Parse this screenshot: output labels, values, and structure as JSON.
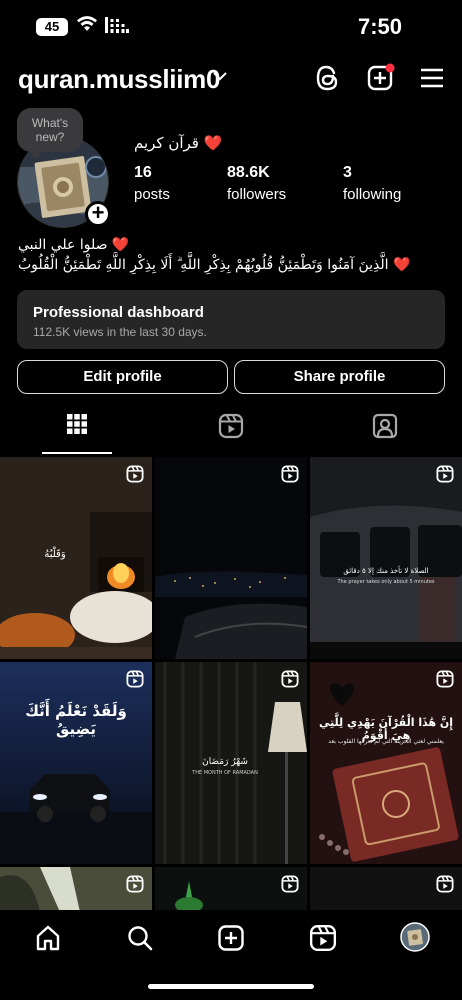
{
  "status_bar": {
    "battery": "45",
    "time": "7:50"
  },
  "header": {
    "username": "quran.mussliim0",
    "icons": [
      "chevron-down-icon",
      "threads-icon",
      "create-icon",
      "menu-icon"
    ],
    "notification_dot_color": "#ff3040"
  },
  "profile": {
    "note_text": "What's new?",
    "display_name": "قرآن كريم ❤️",
    "stats": [
      {
        "value": "16",
        "label": "posts"
      },
      {
        "value": "88.6K",
        "label": "followers"
      },
      {
        "value": "3",
        "label": "following"
      }
    ],
    "bio_line1": "صلوا علي النبي ❤️",
    "bio_line2": "الَّذِينَ آمَنُوا وَتَطْمَئِنُّ قُلُوبُهُمْ بِذِكْرِ اللَّهِ ۗ أَلَا بِذِكْرِ اللَّهِ تَطْمَئِنُّ الْقُلُوبُ ❤️"
  },
  "dashboard": {
    "title": "Professional dashboard",
    "subtitle": "112.5K views in the last 30 days."
  },
  "buttons": {
    "edit": "Edit profile",
    "share": "Share profile"
  },
  "tabs": [
    "grid-icon",
    "reels-icon",
    "tagged-icon"
  ],
  "grid": [
    {
      "caption": "وَقَلْبُهُ",
      "type": "reel"
    },
    {
      "caption": "",
      "type": "reel"
    },
    {
      "caption": "الصلاة لا تأخذ منك إلا ٥ دقائق",
      "subcaption": "The prayer takes only about 5 minutes",
      "type": "reel"
    },
    {
      "caption": "وَلَقَدْ نَعْلَمُ أَنَّكَ يَضِيقُ",
      "type": "reel"
    },
    {
      "caption": "شَهْرُ رَمَضَانَ",
      "subcaption": "THE MONTH OF RAMADAN",
      "type": "reel"
    },
    {
      "caption": "إِنَّ هَٰذَا الْقُرْآنَ يَهْدِي لِلَّتِي هِيَ أَقْوَمُ",
      "subcaption": "يعلمني لغتي الحزينة التي لم تعرفها القلوب بعد",
      "type": "reel"
    },
    {
      "caption": "",
      "type": "reel"
    },
    {
      "caption": "",
      "type": "reel"
    },
    {
      "caption": "",
      "type": "reel"
    }
  ],
  "bottom_nav": [
    "home-icon",
    "search-icon",
    "create-post-icon",
    "reels-nav-icon",
    "profile-avatar"
  ]
}
